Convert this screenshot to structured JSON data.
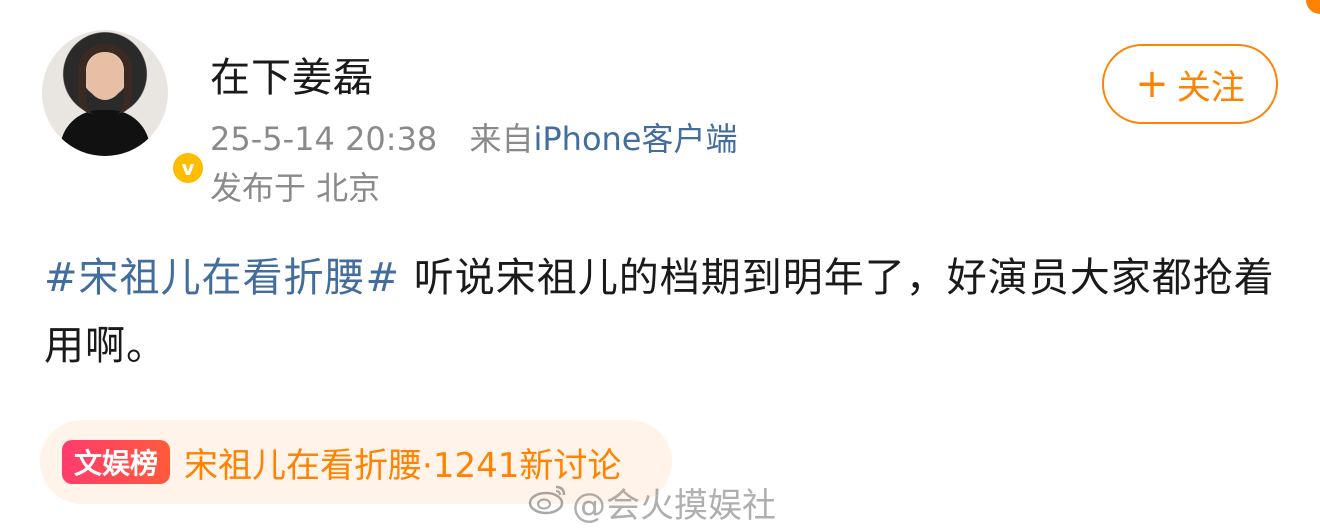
{
  "user": {
    "name": "在下姜磊",
    "verified_mark": "v",
    "timestamp": "25-5-14 20:38",
    "source_prefix": "来自",
    "source": "iPhone客户端",
    "location": "发布于 北京"
  },
  "follow_button": {
    "plus": "+",
    "label": "关注"
  },
  "post": {
    "hashtag": "#宋祖儿在看折腰#",
    "text": " 听说宋祖儿的档期到明年了，好演员大家都抢着用啊。"
  },
  "topic": {
    "badge": "文娱榜",
    "text": "宋祖儿在看折腰·1241新讨论"
  },
  "watermark": {
    "icon": "weibo-icon",
    "text": "@会火摸娱社"
  },
  "colors": {
    "accent": "#ff8200",
    "link": "#436d9c",
    "muted": "#8a8a8a"
  }
}
